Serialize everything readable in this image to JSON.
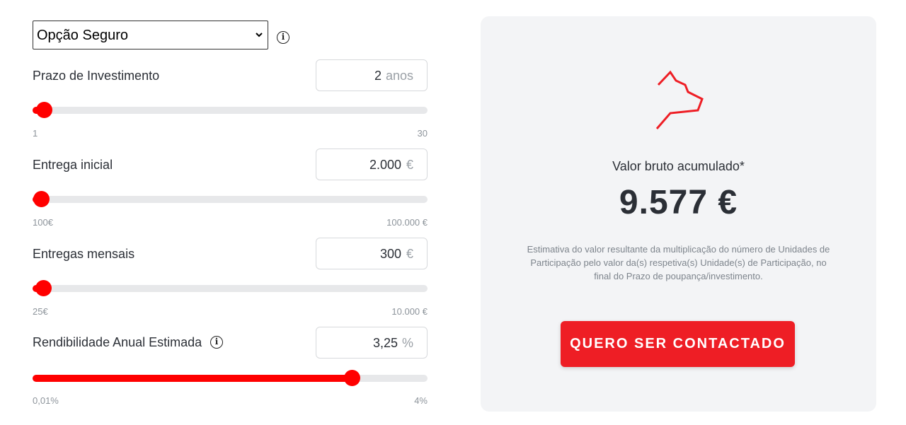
{
  "form": {
    "insurance_select": {
      "value": "Opção Seguro"
    },
    "rows": [
      {
        "label": "Prazo de Investimento",
        "value": "2",
        "unit": "anos",
        "min": "1",
        "max": "30",
        "fill_fraction": 0.03
      },
      {
        "label": "Entrega inicial",
        "value": "2.000",
        "unit": "€",
        "min": "100€",
        "max": "100.000 €",
        "fill_fraction": 0.019
      },
      {
        "label": "Entregas mensais",
        "value": "300",
        "unit": "€",
        "min": "25€",
        "max": "10.000 €",
        "fill_fraction": 0.028
      },
      {
        "label": "Rendibilidade Anual Estimada",
        "value": "3,25",
        "unit": "%",
        "min": "0,01%",
        "max": "4%",
        "fill_fraction": 0.81
      }
    ]
  },
  "result": {
    "label": "Valor bruto acumulado*",
    "value": "9.577 €",
    "disclaimer": "Estimativa do valor resultante da multiplicação do número de Unidades de Participação pelo valor da(s) respetiva(s) Unidade(s) de Participação, no final do Prazo de poupança/investimento.",
    "cta_label": "QUERO SER CONTACTADO"
  },
  "icons": {
    "select_chevron": "chevron-down-icon",
    "info": "info-icon",
    "brand": "brand-mark-icon"
  },
  "colors": {
    "accent": "#ff0000",
    "cta": "#ee1e25",
    "panel_bg": "#f3f4f6",
    "track": "#e7e8ea"
  }
}
